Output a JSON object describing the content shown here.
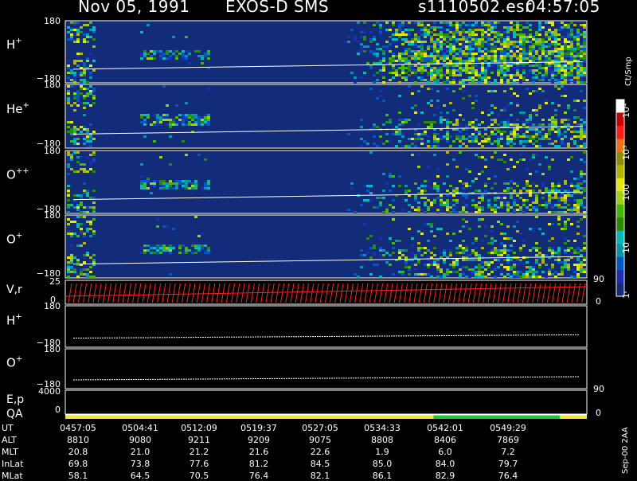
{
  "header": {
    "date": "Nov 05, 1991",
    "instrument": "EXOS-D SMS",
    "file": "s1110502.esr",
    "time": "04:57:05"
  },
  "colorbar": {
    "unit_label": "Ct/Smp",
    "tick_labels": [
      "10⁴",
      "10³",
      "100",
      "10",
      "1"
    ],
    "colors": [
      "#ffffff",
      "#cc0000",
      "#ff1a1a",
      "#f36f0d",
      "#8e8e00",
      "#b3b300",
      "#e8e800",
      "#9ed400",
      "#44b800",
      "#2a8a00",
      "#00bbbb",
      "#0099aa",
      "#0058c8",
      "#1e2db0",
      "#132c7a"
    ]
  },
  "side_label": "Sep-00 2AA",
  "chart_data": [
    {
      "type": "heatmap",
      "panel": "H+",
      "label_main": "H",
      "label_sup": "+",
      "ylim": [
        -180,
        180
      ],
      "yticks": [
        "180",
        "−180"
      ],
      "colorscale": "log counts per sample"
    },
    {
      "type": "heatmap",
      "panel": "He+",
      "label_main": "He",
      "label_sup": "+",
      "ylim": [
        -180,
        180
      ],
      "yticks": [
        "180",
        "−180"
      ],
      "colorscale": "log counts per sample"
    },
    {
      "type": "heatmap",
      "panel": "O++",
      "label_main": "O",
      "label_sup": "++",
      "ylim": [
        -180,
        180
      ],
      "yticks": [
        "180",
        "−180"
      ],
      "colorscale": "log counts per sample"
    },
    {
      "type": "heatmap",
      "panel": "O+",
      "label_main": "O",
      "label_sup": "+",
      "ylim": [
        -180,
        180
      ],
      "yticks": [
        "180",
        "−180"
      ],
      "colorscale": "log counts per sample"
    },
    {
      "type": "line",
      "panel": "V,r",
      "label": "V,r",
      "yticks_left": [
        "25",
        "0"
      ],
      "yticks_right": [
        "90",
        "0"
      ]
    },
    {
      "type": "line",
      "panel": "H+ (line)",
      "label_main": "H",
      "label_sup": "+",
      "yticks": [
        "180",
        "−180"
      ]
    },
    {
      "type": "line",
      "panel": "O+ (line)",
      "label_main": "O",
      "label_sup": "+",
      "yticks": [
        "180",
        "−180"
      ]
    },
    {
      "type": "line",
      "panel": "E,p",
      "label": "E,p",
      "yticks_left": [
        "4000",
        "0"
      ],
      "yticks_right": [
        "90"
      ]
    },
    {
      "type": "bar",
      "panel": "QA",
      "label": "QA",
      "yticks_left": [
        "0"
      ],
      "yticks_right": [
        "0"
      ],
      "segments": [
        {
          "from": "04:57:05",
          "to": "05:38:00",
          "color": "#f2e33a"
        },
        {
          "from": "05:38:00",
          "to": "05:52:00",
          "color": "#22c33a"
        },
        {
          "from": "05:52:00",
          "to": "05:55:00",
          "color": "#f2e33a"
        }
      ]
    }
  ],
  "ephemeris": {
    "row_labels": [
      "UT",
      "ALT",
      "MLT",
      "InLat",
      "MLat"
    ],
    "columns": [
      {
        "UT": "0457:05",
        "ALT": "8810",
        "MLT": "20.8",
        "InLat": "69.8",
        "MLat": "58.1"
      },
      {
        "UT": "0504:41",
        "ALT": "9080",
        "MLT": "21.0",
        "InLat": "73.8",
        "MLat": "64.5"
      },
      {
        "UT": "0512:09",
        "ALT": "9211",
        "MLT": "21.2",
        "InLat": "77.6",
        "MLat": "70.5"
      },
      {
        "UT": "0519:37",
        "ALT": "9209",
        "MLT": "21.6",
        "InLat": "81.2",
        "MLat": "76.4"
      },
      {
        "UT": "0527:05",
        "ALT": "9075",
        "MLT": "22.6",
        "InLat": "84.5",
        "MLat": "82.1"
      },
      {
        "UT": "0534:33",
        "ALT": "8808",
        "MLT": "1.9",
        "InLat": "85.0",
        "MLat": "86.1"
      },
      {
        "UT": "0542:01",
        "ALT": "8406",
        "MLT": "6.0",
        "InLat": "84.0",
        "MLat": "82.9"
      },
      {
        "UT": "0549:29",
        "ALT": "7869",
        "MLT": "7.2",
        "InLat": "79.7",
        "MLat": "76.4"
      }
    ]
  }
}
